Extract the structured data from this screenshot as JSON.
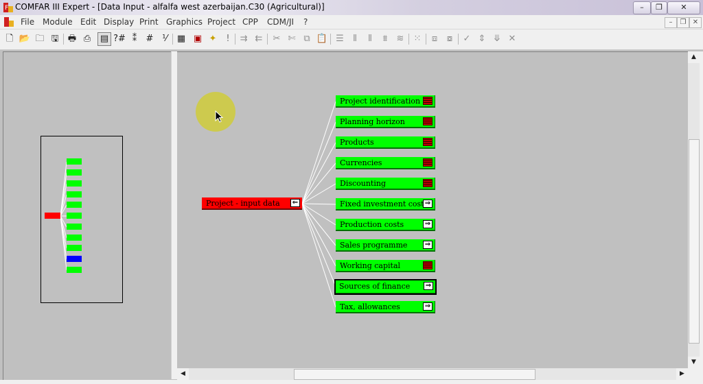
{
  "window": {
    "title": "COMFAR III Expert - [Data Input - alfalfa west azerbaijan.C30 (Agricultural)]",
    "min_icon": "minimize-icon",
    "max_icon": "restore-icon",
    "close_icon": "close-icon"
  },
  "menu": {
    "items": [
      "File",
      "Module",
      "Edit",
      "Display",
      "Print",
      "Graphics",
      "Project",
      "CPP",
      "CDM/JI",
      "?"
    ]
  },
  "toolbar": {
    "icons": [
      "new-icon",
      "open-icon",
      "folder-icon",
      "save-icon",
      "print-icon",
      "print-setup-icon",
      "input-form-icon",
      "help-number-icon",
      "number-format-icon",
      "hash-icon",
      "decimal-icon",
      "grid-icon",
      "calculator-icon",
      "open-folder-star-icon",
      "exclamation-icon",
      "tree-expand-icon",
      "tree-collapse-icon",
      "cut-icon",
      "cut-alt-icon",
      "copy-icon",
      "paste-icon",
      "rows-icon",
      "columns-icon",
      "insert-col-icon",
      "insert-row-icon",
      "wave-icon",
      "dotted-grid-icon",
      "copy-block-icon",
      "move-block-icon",
      "check-icon",
      "up-down-icon",
      "down-check-icon",
      "cross-icon"
    ]
  },
  "tree": {
    "root": {
      "label": "Project - input data",
      "color": "#ff0000"
    },
    "nodes": [
      {
        "label": "Project identification",
        "button": "table"
      },
      {
        "label": "Planning horizon",
        "button": "table"
      },
      {
        "label": "Products",
        "button": "table"
      },
      {
        "label": "Currencies",
        "button": "table"
      },
      {
        "label": "Discounting",
        "button": "table"
      },
      {
        "label": "Fixed investment costs",
        "button": "arrow"
      },
      {
        "label": "Production costs",
        "button": "arrow"
      },
      {
        "label": "Sales programme",
        "button": "arrow"
      },
      {
        "label": "Working capital",
        "button": "table"
      },
      {
        "label": "Sources of finance",
        "button": "arrow",
        "selected": true
      },
      {
        "label": "Tax, allowances",
        "button": "arrow"
      }
    ],
    "node_color": "#00ff00",
    "selected_overview_color": "#0000ff"
  }
}
